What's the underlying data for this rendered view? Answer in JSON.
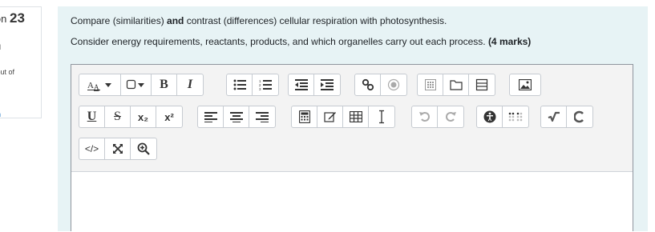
{
  "question_info": {
    "number_label": "ion",
    "number": "23",
    "state_line1": "t",
    "state_line2": "ed",
    "mark_text": "l out of",
    "flag_line1": "g",
    "flag_line2": "on"
  },
  "question": {
    "line1_text": "Compare (similarities) ",
    "line1_bold": "and",
    "line1_rest": " contrast (differences) cellular respiration with photosynthesis.",
    "line2_text": "Consider energy requirements, reactants, products, and which organelles carry out each process. ",
    "line2_bold": "(4 marks)"
  },
  "toolbar": {
    "bold_label": "B",
    "italic_label": "I",
    "underline_label": "U",
    "strike_label": "S",
    "subscript_label": "x₂",
    "superscript_label": "x²",
    "html_label": "</>"
  },
  "editor": {
    "content": ""
  }
}
